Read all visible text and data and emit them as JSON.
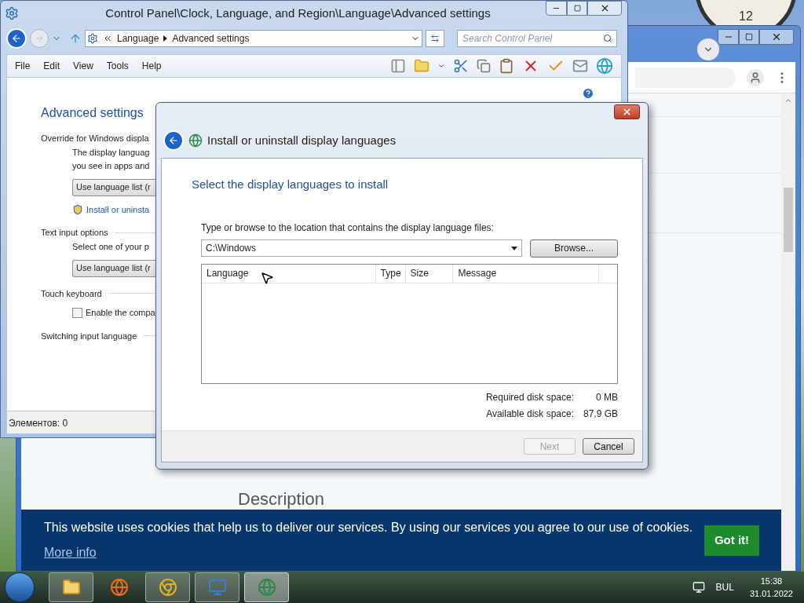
{
  "desktop": {
    "clock_label": "12"
  },
  "browser": {
    "section_heading": "Description",
    "cookie_banner": {
      "message": "This website uses cookies that help us to deliver our services. By using our services you agree to our use of cookies.",
      "link": "More info",
      "button": "Got it!"
    }
  },
  "control_panel": {
    "title": "Control Panel\\Clock, Language, and Region\\Language\\Advanced settings",
    "breadcrumb": [
      "Language",
      "Advanced settings"
    ],
    "search": {
      "placeholder": "Search Control Panel"
    },
    "menu": [
      "File",
      "Edit",
      "View",
      "Tools",
      "Help"
    ],
    "heading": "Advanced settings",
    "items": [
      {
        "kind": "group",
        "text": "Override for Windows displa"
      },
      {
        "kind": "text",
        "text": "The display languag"
      },
      {
        "kind": "text",
        "text": "you see in apps and"
      },
      {
        "kind": "button",
        "text": "Use language list (r"
      },
      {
        "kind": "link",
        "text": "Install or uninsta"
      },
      {
        "kind": "group",
        "text": "Text input options"
      },
      {
        "kind": "text",
        "text": "Select one of your p"
      },
      {
        "kind": "button",
        "text": "Use language list (r"
      },
      {
        "kind": "group",
        "text": "Touch keyboard"
      },
      {
        "kind": "checkbox",
        "text": "Enable the compa",
        "checked": false
      },
      {
        "kind": "group",
        "text": "Switching input language"
      }
    ],
    "status_bar": "Элементов: 0"
  },
  "dialog": {
    "title": "Install or uninstall display languages",
    "heading": "Select the display languages to install",
    "prompt": "Type or browse to the location that contains the display language files:",
    "path": "C:\\Windows",
    "browse": "Browse...",
    "columns": [
      "Language",
      "Type",
      "Size",
      "Message"
    ],
    "disk": [
      {
        "label": "Required disk space:",
        "value": "0 MB"
      },
      {
        "label": "Available disk space:",
        "value": "87,9 GB"
      }
    ],
    "buttons": [
      {
        "label": "Next",
        "disabled": true
      },
      {
        "label": "Cancel",
        "disabled": false
      }
    ]
  },
  "taskbar": {
    "language": "BUL",
    "time": "15:38",
    "date": "31.01.2022"
  }
}
